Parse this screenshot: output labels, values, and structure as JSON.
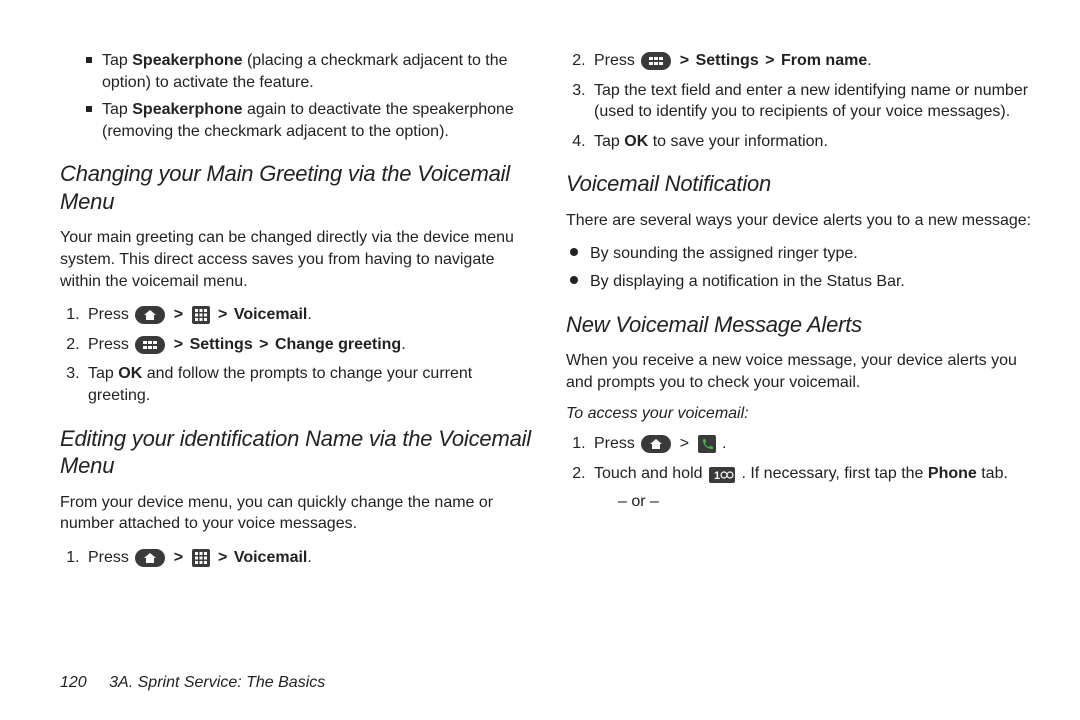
{
  "left": {
    "sq1_a": "Tap ",
    "sq1_b": "Speakerphone",
    "sq1_c": " (placing a checkmark adjacent to the option) to activate the feature.",
    "sq2_a": "Tap ",
    "sq2_b": "Speakerphone",
    "sq2_c": " again to deactivate the speakerphone (removing the checkmark adjacent to the option).",
    "h1": "Changing your Main Greeting via the Voicemail Menu",
    "p1": "Your main greeting can be changed directly via the device menu system. This direct access saves you from having to navigate within the voicemail menu.",
    "l1_a": "Press ",
    "l1_b": "Voicemail",
    "l1_dot": ".",
    "l2_a": "Press ",
    "l2_settings": "Settings",
    "l2_chg": "Change greeting",
    "l2_dot": ".",
    "l3_a": "Tap ",
    "l3_b": "OK",
    "l3_c": " and follow the prompts to change your current greeting.",
    "h2": "Editing your identification Name via the Voicemail Menu",
    "p2": "From your device menu, you can quickly change the name or number attached to your voice messages.",
    "l4_a": "Press ",
    "l4_b": "Voicemail",
    "l4_dot": "."
  },
  "right": {
    "r2_a": "Press ",
    "r2_settings": "Settings",
    "r2_from": "From name",
    "r2_dot": ".",
    "r3": "Tap the text field and enter a new identifying name or number (used to identify you to recipients of your voice messages).",
    "r4_a": "Tap ",
    "r4_b": "OK",
    "r4_c": " to save your information.",
    "h3": "Voicemail Notification",
    "p3": "There are several ways your device alerts you to a new message:",
    "d1": "By sounding the assigned ringer type.",
    "d2": "By displaying a notification in the Status Bar.",
    "h4": "New Voicemail Message Alerts",
    "p4": "When you receive a new voice message, your device alerts you and prompts you to check your voicemail.",
    "lead": "To access your voicemail:",
    "a1_a": "Press ",
    "a1_dot": " .",
    "a2_a": "Touch and hold ",
    "a2_b": ". If necessary, first tap the ",
    "a2_c": "Phone",
    "a2_d": " tab.",
    "or": "– or –"
  },
  "sep": " > ",
  "footer": {
    "page": "120",
    "title": "3A. Sprint Service: The Basics"
  }
}
